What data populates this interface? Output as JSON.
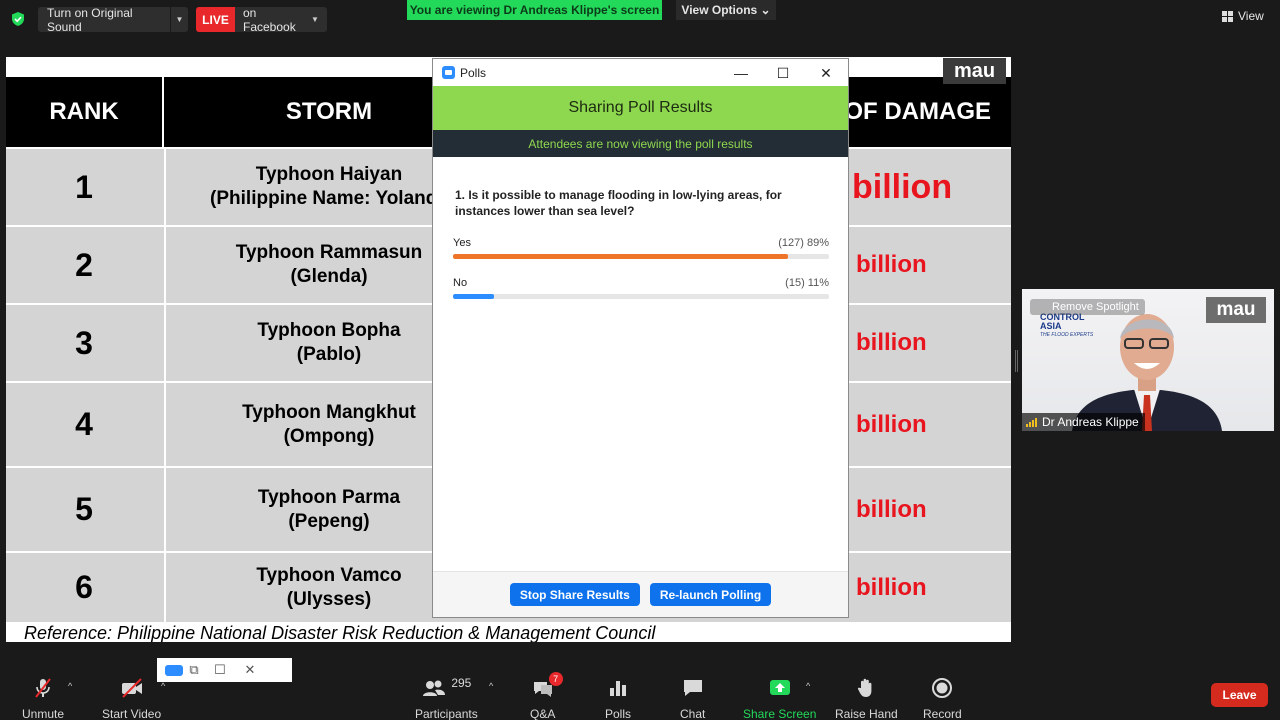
{
  "topbar": {
    "original_sound_label": "Turn on Original Sound",
    "live_badge": "LIVE",
    "live_target": "on Facebook",
    "viewing_banner": "You are viewing Dr Andreas Klippe's screen",
    "view_options": "View Options ⌄",
    "view_label": "View"
  },
  "slide": {
    "brand": "mau",
    "headers": {
      "rank": "RANK",
      "storm": "STORM",
      "damage": "OF DAMAGE"
    },
    "rows": [
      {
        "rank": "1",
        "storm_line1": "Typhoon Haiyan",
        "storm_line2": "(Philippine Name: Yolanda",
        "damage": "billion"
      },
      {
        "rank": "2",
        "storm_line1": "Typhoon Rammasun",
        "storm_line2": "(Glenda)",
        "damage": "billion"
      },
      {
        "rank": "3",
        "storm_line1": "Typhoon Bopha",
        "storm_line2": "(Pablo)",
        "damage": "billion"
      },
      {
        "rank": "4",
        "storm_line1": "Typhoon Mangkhut",
        "storm_line2": "(Ompong)",
        "damage": "billion"
      },
      {
        "rank": "5",
        "storm_line1": "Typhoon Parma",
        "storm_line2": "(Pepeng)",
        "damage": "billion"
      },
      {
        "rank": "6",
        "storm_line1": "Typhoon Vamco",
        "storm_line2": "(Ulysses)",
        "damage": "billion"
      }
    ],
    "reference": "Reference: Philippine National Disaster Risk Reduction & Management Council"
  },
  "poll": {
    "window_title": "Polls",
    "header": "Sharing Poll Results",
    "subheader": "Attendees are now viewing the poll results",
    "question": "1. Is it possible to manage flooding in low-lying areas, for instances lower than sea level?",
    "options": [
      {
        "label": "Yes",
        "stat": "(127) 89%",
        "percent": 89,
        "color": "#ee7429"
      },
      {
        "label": "No",
        "stat": "(15) 11%",
        "percent": 11,
        "color": "#2d8cff"
      }
    ],
    "stop_button": "Stop Share Results",
    "relaunch_button": "Re-launch Polling"
  },
  "video": {
    "brand": "mau",
    "spotlight_label": "Remove Spotlight",
    "logo_line1": "CONTROL",
    "logo_line2": "ASIA",
    "logo_tagline": "THE FLOOD EXPERTS",
    "speaker_name": "Dr Andreas Klippe"
  },
  "toolbar": {
    "unmute": "Unmute",
    "start_video": "Start Video",
    "participants_count": "295",
    "participants": "Participants",
    "qa_badge": "7",
    "qa": "Q&A",
    "polls": "Polls",
    "chat": "Chat",
    "share_screen": "Share Screen",
    "raise_hand": "Raise Hand",
    "record": "Record",
    "leave": "Leave"
  }
}
